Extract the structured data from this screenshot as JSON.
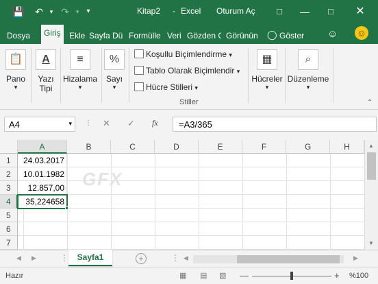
{
  "title": {
    "filename": "Kitap2",
    "app_separator": "-",
    "app": "Excel",
    "signin": "Oturum Aç"
  },
  "tabs": [
    "Dosya",
    "Giriş",
    "Ekle",
    "Sayfa Dü",
    "Formülle",
    "Veri",
    "Gözden G",
    "Görünün",
    "Göster"
  ],
  "ribbon": {
    "pano": "Pano",
    "yazi_tipi_1": "Yazı",
    "yazi_tipi_2": "Tipi",
    "hizalama": "Hizalama",
    "sayi": "Sayı",
    "kosullu": "Koşullu Biçimlendirme",
    "tablo": "Tablo Olarak Biçimlendir",
    "hucre_stilleri": "Hücre Stilleri",
    "stiller": "Stiller",
    "hucreler": "Hücreler",
    "duzenleme": "Düzenleme"
  },
  "formula": {
    "namebox": "A4",
    "fx": "fx",
    "content": "=A3/365"
  },
  "columns": [
    "A",
    "B",
    "C",
    "D",
    "E",
    "F",
    "G",
    "H"
  ],
  "rows": [
    "1",
    "2",
    "3",
    "4",
    "5",
    "6",
    "7"
  ],
  "cells": {
    "A1": "24.03.2017",
    "A2": "10.01.1982",
    "A3": "12.857,00",
    "A4": "35,224658"
  },
  "watermark": "GFX",
  "sheet": {
    "active": "Sayfa1"
  },
  "status": {
    "ready": "Hazır",
    "zoom": "%100"
  },
  "colors": {
    "brand": "#217346"
  }
}
